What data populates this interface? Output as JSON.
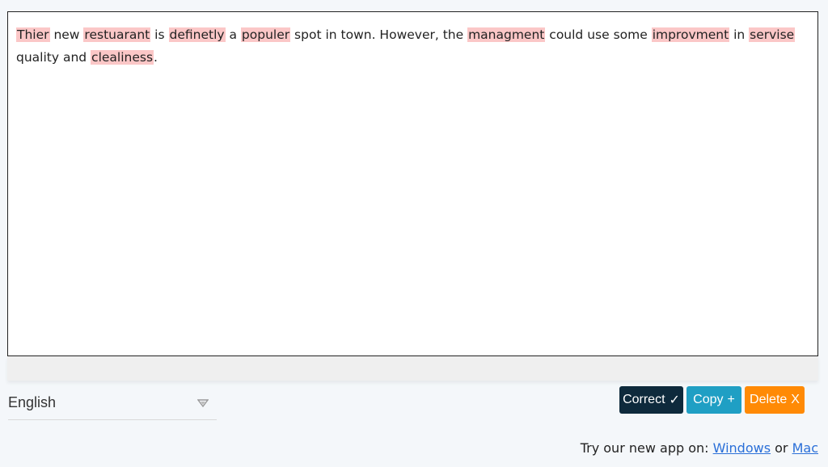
{
  "editor": {
    "segments": [
      {
        "text": "Thier",
        "error": true
      },
      {
        "text": " new ",
        "error": false
      },
      {
        "text": "restuarant",
        "error": true
      },
      {
        "text": " is ",
        "error": false
      },
      {
        "text": "definetly",
        "error": true
      },
      {
        "text": " a ",
        "error": false
      },
      {
        "text": "populer",
        "error": true
      },
      {
        "text": " spot in town. However, the ",
        "error": false
      },
      {
        "text": "managment",
        "error": true
      },
      {
        "text": " could use some ",
        "error": false
      },
      {
        "text": "improvment",
        "error": true
      },
      {
        "text": " in ",
        "error": false
      },
      {
        "text": "servise",
        "error": true
      },
      {
        "text": " quality and ",
        "error": false
      },
      {
        "text": "clealiness",
        "error": true
      },
      {
        "text": ".",
        "error": false
      }
    ],
    "error_highlight_color": "#fbc7c7"
  },
  "language": {
    "selected": "English",
    "icon": "dropdown-arrow-icon"
  },
  "actions": {
    "correct_label": "Correct",
    "correct_symbol": "✓",
    "copy_label": "Copy",
    "copy_symbol": "+",
    "delete_label": "Delete",
    "delete_symbol": "X",
    "colors": {
      "correct": "#0e2a3c",
      "copy": "#1f9fc4",
      "delete": "#ff8a05"
    }
  },
  "promo": {
    "prefix": "Try our new app on: ",
    "windows_link": "Windows",
    "separator": " or ",
    "mac_link": "Mac"
  }
}
